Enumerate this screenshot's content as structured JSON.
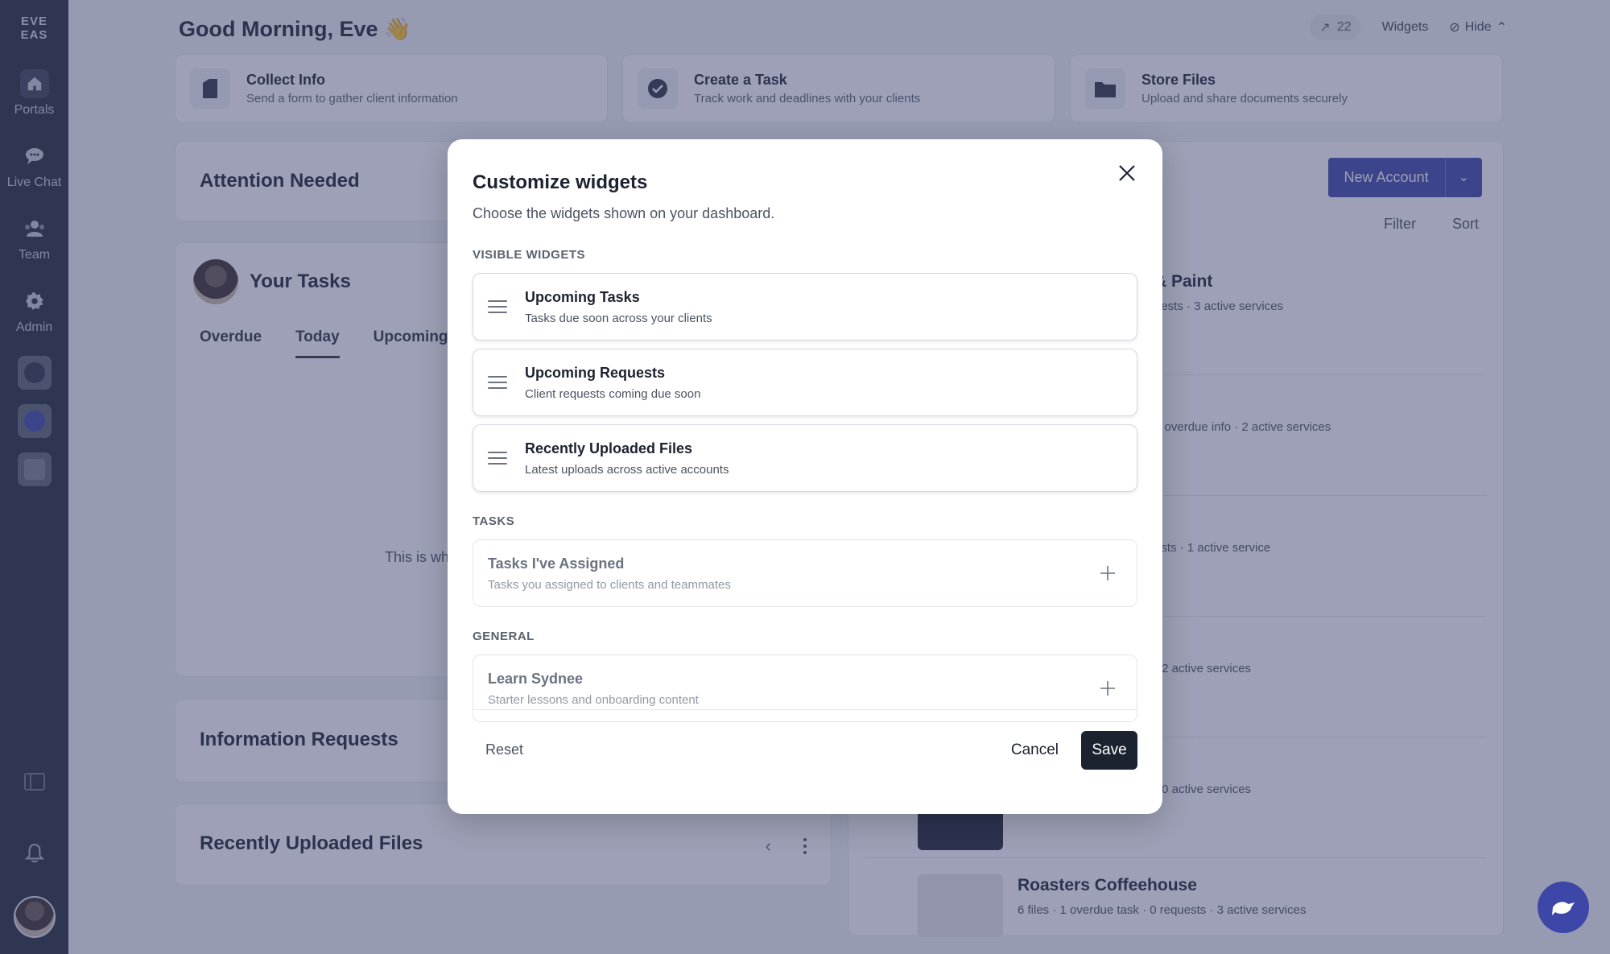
{
  "sidebar": {
    "logo": "EVE EAS",
    "items": [
      {
        "label": "Portals",
        "icon": "home-icon"
      },
      {
        "label": "Live Chat",
        "icon": "chat-icon"
      },
      {
        "label": "Team",
        "icon": "team-icon"
      },
      {
        "label": "Admin",
        "icon": "gear-icon"
      }
    ]
  },
  "header": {
    "greeting": "Good Morning, Eve 👋",
    "trend_count": "22",
    "widgets_label": "Widgets",
    "hide_label": "Hide"
  },
  "quick_actions": [
    {
      "title": "Collect Info",
      "subtitle": "Send a form to gather client information"
    },
    {
      "title": "Create a Task",
      "subtitle": "Track work and deadlines with your clients"
    },
    {
      "title": "Store Files",
      "subtitle": "Upload and share documents securely"
    }
  ],
  "dashboard": {
    "attention_title": "Attention Needed",
    "tasks_title": "Your Tasks",
    "tabs": [
      "Overdue",
      "Today",
      "Upcoming"
    ],
    "empty_text": "This is wh",
    "info_requests_title": "Information Requests",
    "recent_files_title": "Recently Uploaded Files",
    "new_account_label": "New Account",
    "filter_label": "Filter",
    "sort_label": "Sort",
    "accounts": [
      {
        "name": "& Paint",
        "meta": "uests ·  3 active services"
      },
      {
        "name": "",
        "meta": "1 overdue info ·  2 active services"
      },
      {
        "name": "",
        "meta": "ests ·  1 active service"
      },
      {
        "name": "",
        "meta": "·  2 active services"
      },
      {
        "name": "",
        "meta": "·  0 active services"
      },
      {
        "name": "Roasters Coffeehouse",
        "meta": "6 files ·  1 overdue task ·  0 requests ·  3 active services"
      }
    ]
  },
  "modal": {
    "title": "Customize widgets",
    "subtitle": "Choose the widgets shown on your dashboard.",
    "visible_label": "Visible Widgets",
    "visible": [
      {
        "title": "Upcoming Tasks",
        "subtitle": "Tasks due soon across your clients"
      },
      {
        "title": "Upcoming Requests",
        "subtitle": "Client requests coming due soon"
      },
      {
        "title": "Recently Uploaded Files",
        "subtitle": "Latest uploads across active accounts"
      }
    ],
    "tasks_label": "Tasks",
    "tasks": [
      {
        "title": "Tasks I've Assigned",
        "subtitle": "Tasks you assigned to clients and teammates"
      }
    ],
    "general_label": "General",
    "general": [
      {
        "title": "Learn Sydnee",
        "subtitle": "Starter lessons and onboarding content"
      }
    ],
    "reset_label": "Reset",
    "cancel_label": "Cancel",
    "save_label": "Save"
  },
  "colors": {
    "accent": "#3d47a8",
    "sidebar": "#232a35",
    "primary_button": "#1c2330"
  }
}
